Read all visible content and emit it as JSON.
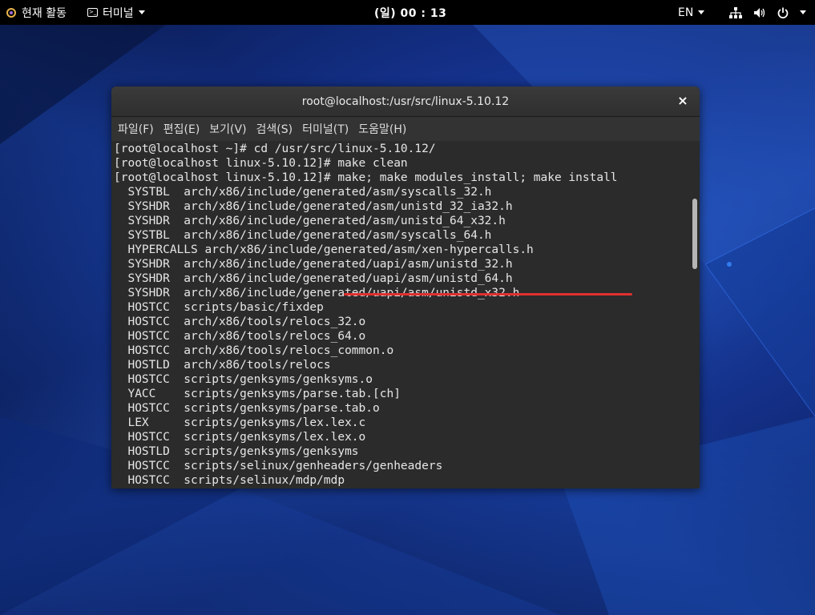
{
  "topbar": {
    "activities": "현재 활동",
    "app_menu": "터미널",
    "clock": "(일) 00 : 13",
    "language": "EN",
    "icons": [
      "network-icon",
      "volume-icon",
      "power-icon"
    ]
  },
  "window": {
    "title": "root@localhost:/usr/src/linux-5.10.12",
    "close_glyph": "×",
    "menu": [
      "파일(F)",
      "편집(E)",
      "보기(V)",
      "검색(S)",
      "터미널(T)",
      "도움말(H)"
    ]
  },
  "terminal": {
    "lines": [
      "[root@localhost ~]# cd /usr/src/linux-5.10.12/",
      "[root@localhost linux-5.10.12]# make clean",
      "[root@localhost linux-5.10.12]# make; make modules_install; make install",
      "  SYSTBL  arch/x86/include/generated/asm/syscalls_32.h",
      "  SYSHDR  arch/x86/include/generated/asm/unistd_32_ia32.h",
      "  SYSHDR  arch/x86/include/generated/asm/unistd_64_x32.h",
      "  SYSTBL  arch/x86/include/generated/asm/syscalls_64.h",
      "  HYPERCALLS arch/x86/include/generated/asm/xen-hypercalls.h",
      "  SYSHDR  arch/x86/include/generated/uapi/asm/unistd_32.h",
      "  SYSHDR  arch/x86/include/generated/uapi/asm/unistd_64.h",
      "  SYSHDR  arch/x86/include/generated/uapi/asm/unistd_x32.h",
      "  HOSTCC  scripts/basic/fixdep",
      "  HOSTCC  arch/x86/tools/relocs_32.o",
      "  HOSTCC  arch/x86/tools/relocs_64.o",
      "  HOSTCC  arch/x86/tools/relocs_common.o",
      "  HOSTLD  arch/x86/tools/relocs",
      "  HOSTCC  scripts/genksyms/genksyms.o",
      "  YACC    scripts/genksyms/parse.tab.[ch]",
      "  HOSTCC  scripts/genksyms/parse.tab.o",
      "  LEX     scripts/genksyms/lex.lex.c",
      "  HOSTCC  scripts/genksyms/lex.lex.o",
      "  HOSTLD  scripts/genksyms/genksyms",
      "  HOSTCC  scripts/selinux/genheaders/genheaders",
      "  HOSTCC  scripts/selinux/mdp/mdp"
    ],
    "highlight_color": "#e03030"
  }
}
